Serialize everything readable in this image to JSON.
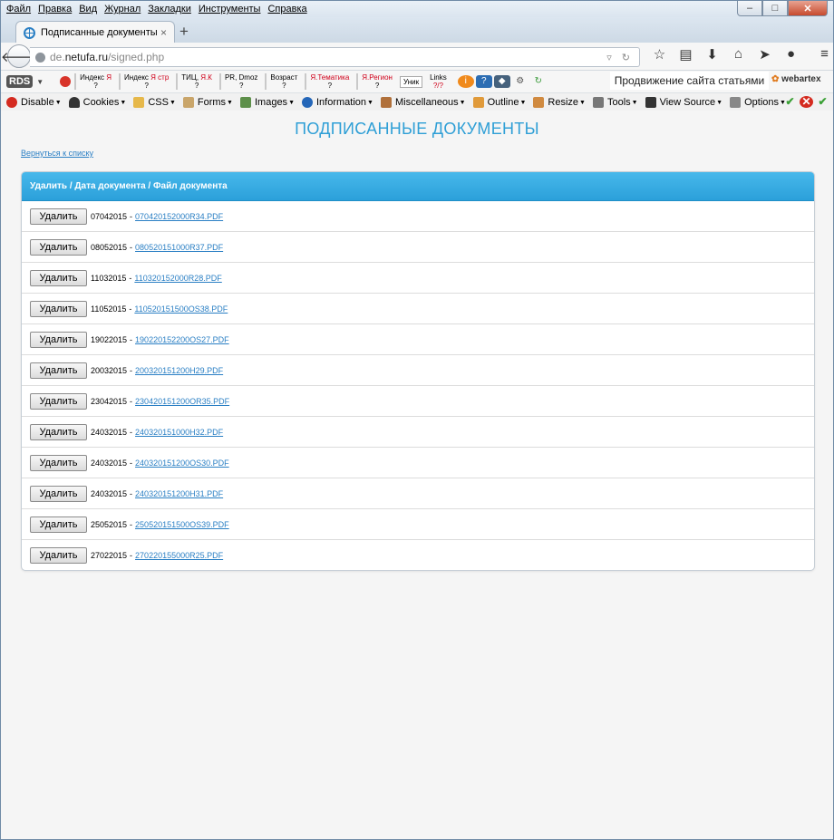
{
  "menu": [
    "Файл",
    "Правка",
    "Вид",
    "Журнал",
    "Закладки",
    "Инструменты",
    "Справка"
  ],
  "tab": {
    "title": "Подписанные документы",
    "close": "×",
    "new": "+"
  },
  "url": {
    "host_prefix": "de.",
    "host": "netufa.ru",
    "path": "/signed.php"
  },
  "rds": {
    "logo": "RDS",
    "items": [
      {
        "label": "Индекс",
        "suffix": "Я",
        "value": "?"
      },
      {
        "label": "Индекс",
        "suffix": "Я стр",
        "value": "?"
      },
      {
        "label": "ТИЦ,",
        "suffix": "Я.К",
        "value": "?"
      },
      {
        "label": "PR, Dmoz",
        "suffix": "",
        "value": "?"
      },
      {
        "label": "Возраст",
        "suffix": "",
        "value": "?"
      },
      {
        "label": "",
        "suffix": "Я.Тематика",
        "value": "?"
      },
      {
        "label": "",
        "suffix": "Я.Регион",
        "value": "?"
      }
    ],
    "unik": "Уник",
    "links": {
      "label": "Links",
      "value": "?/?"
    },
    "promo": "Продвижение сайта статьями",
    "webartex": "webartex"
  },
  "webdev": [
    "Disable",
    "Cookies",
    "CSS",
    "Forms",
    "Images",
    "Information",
    "Miscellaneous",
    "Outline",
    "Resize",
    "Tools",
    "View Source",
    "Options"
  ],
  "page": {
    "title": "ПОДПИСАННЫЕ ДОКУМЕНТЫ",
    "back_link": "Вернуться к списку",
    "table_header": "Удалить / Дата документа / Файл документа",
    "delete_label": "Удалить",
    "rows": [
      {
        "date": "07042015",
        "file": "070420152000R34.PDF"
      },
      {
        "date": "08052015",
        "file": "080520151000R37.PDF"
      },
      {
        "date": "11032015",
        "file": "110320152000R28.PDF"
      },
      {
        "date": "11052015",
        "file": "110520151500OS38.PDF"
      },
      {
        "date": "19022015",
        "file": "190220152200OS27.PDF"
      },
      {
        "date": "20032015",
        "file": "200320151200H29.PDF"
      },
      {
        "date": "23042015",
        "file": "230420151200OR35.PDF"
      },
      {
        "date": "24032015",
        "file": "240320151000H32.PDF"
      },
      {
        "date": "24032015",
        "file": "240320151200OS30.PDF"
      },
      {
        "date": "24032015",
        "file": "240320151200H31.PDF"
      },
      {
        "date": "25052015",
        "file": "250520151500OS39.PDF"
      },
      {
        "date": "27022015",
        "file": "270220155000R25.PDF"
      }
    ]
  }
}
